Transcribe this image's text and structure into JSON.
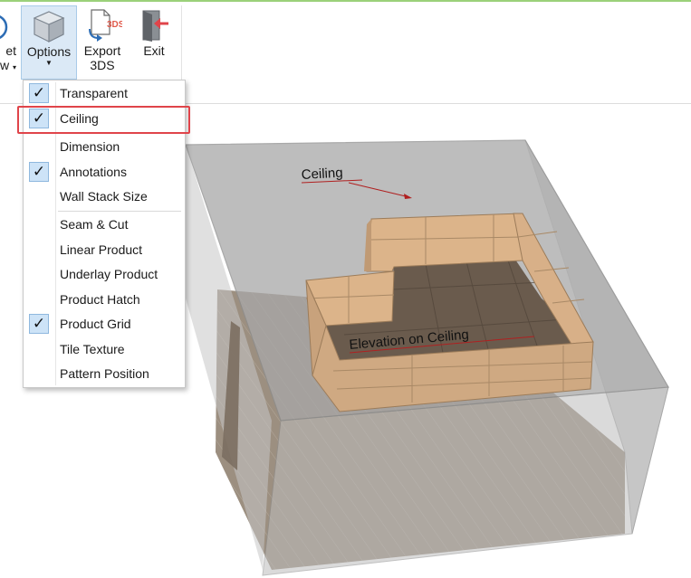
{
  "ribbon": {
    "reset_view": {
      "line1": "et",
      "line2": "w"
    },
    "options": {
      "label": "Options"
    },
    "export": {
      "line1": "Export",
      "line2": "3DS",
      "badge": "3DS"
    },
    "exit": {
      "label": "Exit"
    }
  },
  "menu": {
    "items": [
      {
        "label": "Transparent",
        "checked": true
      },
      {
        "label": "Ceiling",
        "checked": true
      },
      {
        "label": "Dimension",
        "checked": false
      },
      {
        "label": "Annotations",
        "checked": true
      },
      {
        "label": "Wall Stack Size",
        "checked": false
      },
      {
        "label": "Seam & Cut",
        "checked": false
      },
      {
        "label": "Linear Product",
        "checked": false
      },
      {
        "label": "Underlay Product",
        "checked": false
      },
      {
        "label": "Product Hatch",
        "checked": false
      },
      {
        "label": "Product Grid",
        "checked": true
      },
      {
        "label": "Tile Texture",
        "checked": false
      },
      {
        "label": "Pattern Position",
        "checked": false
      }
    ],
    "check_glyph": "✓"
  },
  "viewport": {
    "annotation_ceiling": "Ceiling",
    "annotation_elevation": "Elevation on Ceiling"
  },
  "colors": {
    "accent_green": "#9bd17a",
    "highlight_red": "#e0444a",
    "ceiling_tile": "#d9b48a",
    "floor": "#7d6b57"
  }
}
